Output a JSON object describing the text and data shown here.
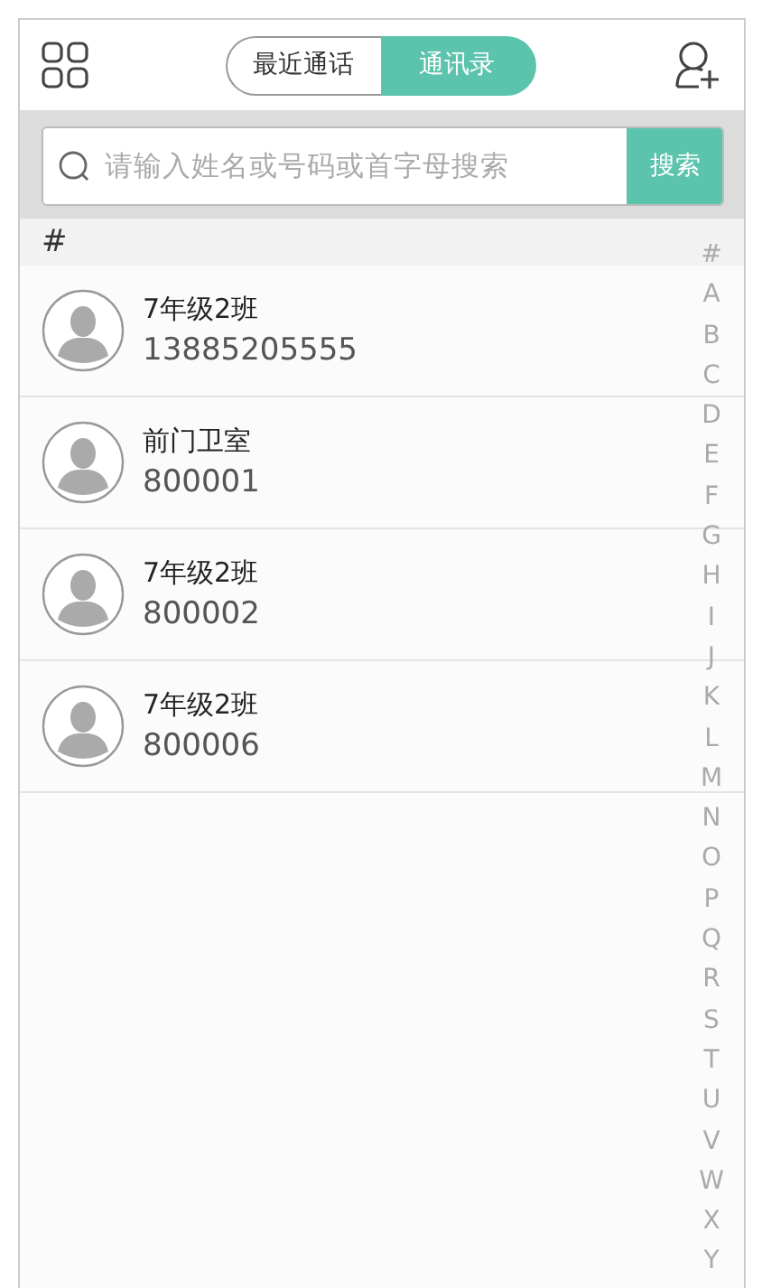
{
  "tabs": [
    {
      "label": "最近通话",
      "selected": false
    },
    {
      "label": "通讯录",
      "selected": true
    }
  ],
  "search": {
    "placeholder": "请输入姓名或号码或首字母搜索",
    "button": "搜索"
  },
  "section": "#",
  "contacts": [
    {
      "name": "7年级2班",
      "number": "13885205555"
    },
    {
      "name": "前门卫室",
      "number": "800001"
    },
    {
      "name": "7年级2班",
      "number": "800002"
    },
    {
      "name": "7年级2班",
      "number": "800006"
    }
  ],
  "index": [
    "#",
    "A",
    "B",
    "C",
    "D",
    "E",
    "F",
    "G",
    "H",
    "I",
    "J",
    "K",
    "L",
    "M",
    "N",
    "O",
    "P",
    "Q",
    "R",
    "S",
    "T",
    "U",
    "V",
    "W",
    "X",
    "Y"
  ]
}
